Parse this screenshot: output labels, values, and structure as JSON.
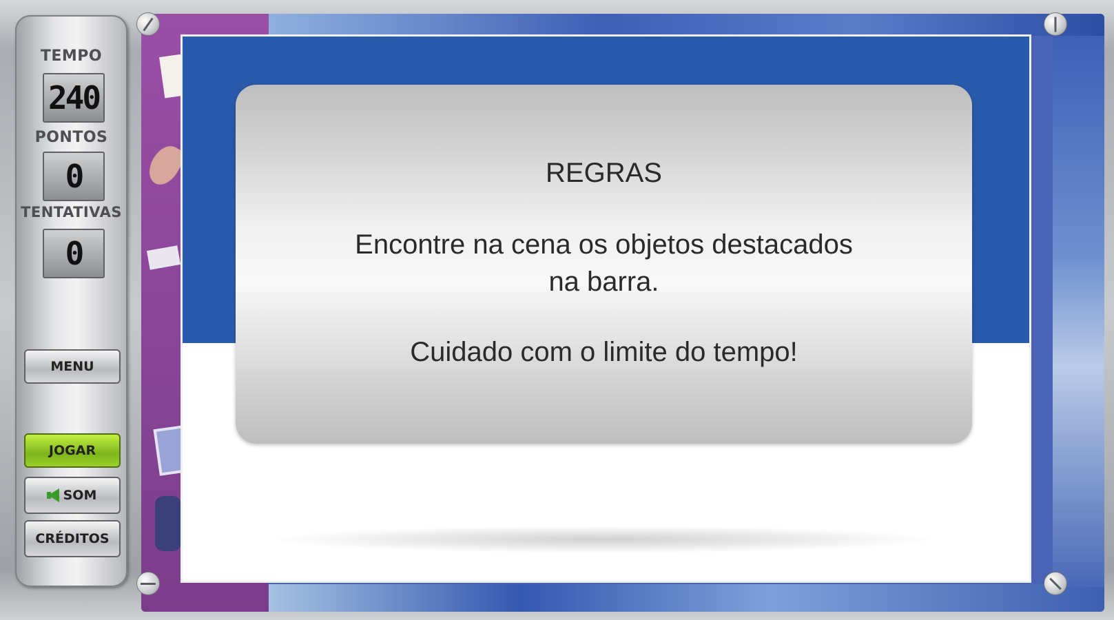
{
  "stats": {
    "tempo_label": "TEMPO",
    "tempo_value": "240",
    "pontos_label": "PONTOS",
    "pontos_value": "0",
    "tentativas_label": "TENTATIVAS",
    "tentativas_value": "0"
  },
  "buttons": {
    "menu": "MENU",
    "jogar": "JOGAR",
    "som": "SOM",
    "creditos": "CRÉDITOS"
  },
  "dialog": {
    "title": "REGRAS",
    "line1": "Encontre na cena os objetos destacados",
    "line2": "na barra.",
    "line3": "Cuidado com o limite do tempo!"
  },
  "colors": {
    "play_button": "#8cc71f",
    "board_band": "#2a5aab"
  },
  "icons": {
    "sound": "speaker-icon"
  }
}
